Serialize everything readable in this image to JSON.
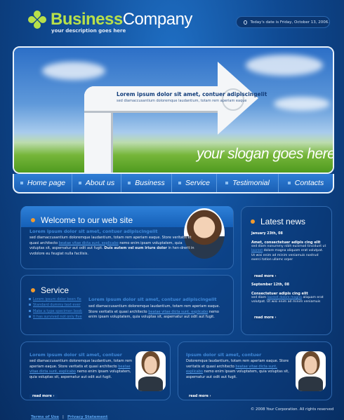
{
  "header": {
    "brand_part1": "Business",
    "brand_part2": "Company",
    "tagline": "your description goes here",
    "date": "Today's date is Friday, October 13, 2006."
  },
  "hero": {
    "title": "Lorem ipsum dolor sit amet, contuer adipiscingelit",
    "subtitle": "sed diamaccusantium doloremque laudantium, totam rem aperiam eaque",
    "slogan": "your slogan goes here"
  },
  "nav": {
    "items": [
      {
        "label": "Home page"
      },
      {
        "label": "About us"
      },
      {
        "label": "Business"
      },
      {
        "label": "Service"
      },
      {
        "label": "Testimonial"
      },
      {
        "label": "Contacts"
      }
    ]
  },
  "welcome": {
    "title": "Welcome to our web site",
    "lead": "Lorem ipsum dolor sit amet, contuer adipiscingelit",
    "text1": "sed diamaccusantium doloremque laudantium, totam rem aperiam eaque. Store veritatis et quasi architecto",
    "link": "beatae vitae dicta sunt, explicabo",
    "text2": "nemo enim ipsam voluptatem, quia voluptas sit, aspernatur aut odit aut fugit.",
    "bold": "Duis autem vel eum iriure dolor",
    "text3": "in hen-drerit in vvdolore eu feugiat nulla facilisis."
  },
  "news": {
    "title": "Latest news",
    "items": [
      {
        "date": "January 23th, 08",
        "headline": "Amet, consectetuer adipis cing elit",
        "text1": "sed diam nonummy nibh euismod tincidunt ut",
        "link": "laoreet",
        "text2": "dolore magna aliquam erat volutpat.  Ut wisi enim ad minim veniamuis nostrud exerci tation ullamc orper",
        "more": "read more"
      },
      {
        "date": "September 12th, 08",
        "headline": "Consectetuer adipis cing elit",
        "text1": "sed diam",
        "link": "laoreet dolore magna",
        "text2": "aliquam erat volutpat.  Ut wisi enim ad minim veniamuis",
        "more": "read more"
      }
    ]
  },
  "service": {
    "title": "Service",
    "list": [
      "Lorem ipsum dolor been fle",
      "Standard dummy text ever",
      "Make a type specimen book",
      "It has survived not only five"
    ],
    "lead": "Lorem ipsum dolor sit amet, contuer adipiscingelit",
    "text1": "sed diamaccusantium doloremque laudantium, totam rem aperiam eaque. Store veritatis et quasi architecto",
    "link": "beatae vitae dicta sunt, explicabo",
    "text2": "nemo enim ipsam voluptatem, quia voluptas sit, aspernatur aut odit aut fugit."
  },
  "bottom_left": {
    "lead": "Lorem ipsum dolor sit amet, contuer",
    "text1": "sed diamaccusantium doloremque laudantium, totam rem aperiam eaque. Store veritatis et quasi architecto",
    "link": "beatae vitae dicta sunt, explicabo",
    "text2": "nemo enim ipsam voluptatem, quia voluptas sit, aspernatur aut odit aut fugit.",
    "more": "read more"
  },
  "bottom_right": {
    "lead": "Ipsum dolor sit amet, contuer",
    "text1": "Doloremque laudantium, totam rem aperiam eaque. Store veritatis et quasi architecto",
    "link": "beatae vitae dicta sunt, explicabo",
    "text2": "nemo enim ipsam voluptatem, quia voluptas sit, aspernatur aut odit aut fugit.",
    "more": "read more"
  },
  "footer": {
    "terms": "Terms of Use",
    "sep": "|",
    "privacy": "Privacy Statement",
    "copyright": "© 2008 Your Corporation. All rights reserved"
  },
  "colors": {
    "accent_green": "#b8e04a",
    "link_blue": "#3f88d8",
    "bullet_orange": "#f29a2e",
    "background": "#0d3f83"
  },
  "icons": {
    "logo": "flower-logo-icon",
    "clock": "clock-icon",
    "bullet": "orange-bullet-icon",
    "play": "play-circle-icon"
  }
}
